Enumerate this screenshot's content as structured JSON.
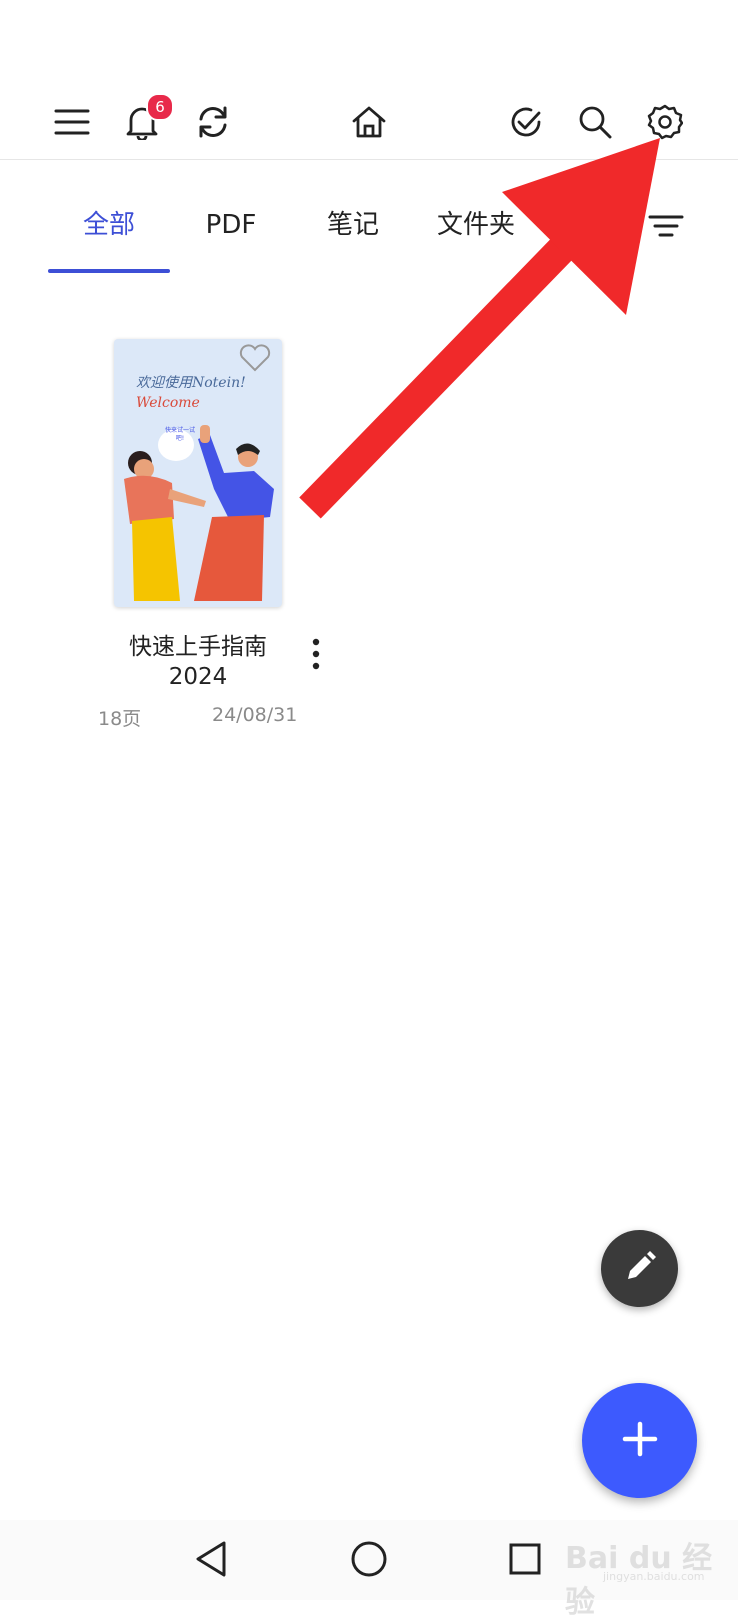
{
  "notification_count": "6",
  "tabs": [
    {
      "label": "全部",
      "active": true
    },
    {
      "label": "PDF",
      "active": false
    },
    {
      "label": "笔记",
      "active": false
    },
    {
      "label": "文件夹",
      "active": false
    }
  ],
  "document": {
    "title": "快速上手指南2024",
    "title_line1": "快速上手指南",
    "title_line2": "2024",
    "pages": "18页",
    "date": "24/08/31",
    "cover_text_1": "欢迎使用Notein!",
    "cover_text_2": "Welcome",
    "cover_bubble": "快来试一试吧!"
  },
  "watermark": {
    "brand": "Bai du 经验",
    "url": "jingyan.baidu.com"
  },
  "colors": {
    "accent": "#3d4fd6",
    "fab_add": "#3d5afe",
    "fab_edit": "#3a3a3a",
    "badge": "#e8294a",
    "arrow": "#f0292a"
  },
  "icons": {
    "menu": "menu-icon",
    "bell": "bell-icon",
    "sync": "sync-icon",
    "home": "home-icon",
    "check": "check-circle-icon",
    "search": "search-icon",
    "settings": "gear-icon",
    "list_view": "list-view-icon",
    "filter": "filter-icon",
    "more": "more-vertical-icon",
    "edit": "pencil-icon",
    "add": "plus-icon",
    "back": "nav-back-icon",
    "nav_home": "nav-home-icon",
    "recents": "nav-recents-icon"
  }
}
